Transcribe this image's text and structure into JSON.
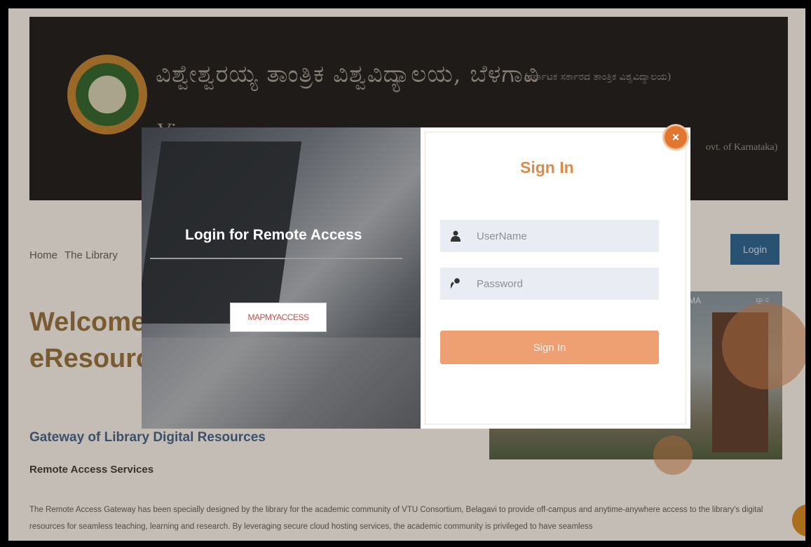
{
  "header": {
    "kannada_title": "ವಿಶ್ವೇಶ್ವರಯ್ಯ ತಾಂತ್ರಿಕ ವಿಶ್ವವಿದ್ಯಾಲಯ, ಬೆಳಗಾವಿ",
    "kannada_subtitle": "(ಕರ್ನಾಟಕ ಸರ್ಕಾರದ ತಾಂತ್ರಿಕ ವಿಶ್ವವಿದ್ಯಾಲಯ)",
    "english_title_prefix": "Vi",
    "english_title_right": "ovt. of Karnataka)"
  },
  "nav": {
    "home": "Home",
    "library": "The Library",
    "login": "Login"
  },
  "main": {
    "welcome_line1": "Welcome",
    "welcome_line2": "eResourc",
    "gateway": "Gateway of Library Digital Resources",
    "remote_heading": "Remote Access Services",
    "paragraph": "The Remote Access Gateway has been specially designed by the library for the academic community of VTU Consortium, Belagavi to provide off-campus and anytime-anywhere access to the library's digital resources for seamless teaching, learning and research. By leveraging secure cloud hosting services, the academic community is privileged to have seamless",
    "campus_label": "AMA",
    "campus_label2": "ಜ್ಞಾನ"
  },
  "modal": {
    "left_title": "Login for Remote Access",
    "mapmyaccess_label": "MAPMYACCESS",
    "signin_title": "Sign In",
    "close_symbol": "×",
    "username_placeholder": "UserName",
    "password_placeholder": "Password",
    "signin_button": "Sign In"
  },
  "colors": {
    "accent_orange": "#e08a4a",
    "signin_button": "#efa073",
    "login_button": "#2a5d86"
  },
  "icons": {
    "user": "user-icon",
    "key": "key-icon",
    "close": "close-icon"
  }
}
